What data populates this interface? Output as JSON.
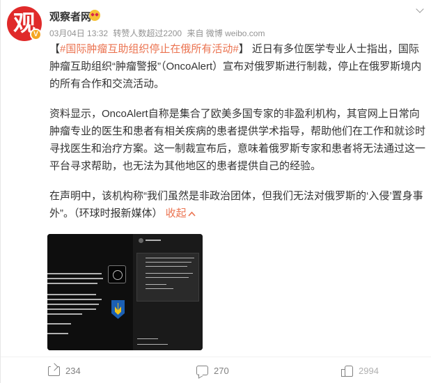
{
  "header": {
    "avatar_glyph": "观",
    "user_name": "观察者网",
    "emoji_icon": "heart-eyes-emoji-icon",
    "date": "03月04日 13:32",
    "reposts_over": "转赞人数超过2200",
    "source": "来自 微博 weibo.com"
  },
  "post": {
    "bracket_open": "【",
    "hashtag": "#国际肿瘤互助组织停止在俄所有活动#",
    "bracket_close": "】",
    "p1_text": "近日有多位医学专业人士指出，国际肿瘤互助组织“肿瘤警报”（OncoAlert）宣布对俄罗斯进行制裁，停止在俄罗斯境内的所有合作和交流活动。",
    "p2_text": "资料显示，OncoAlert自称是集合了欧美多国专家的非盈利机构，其官网上日常向肿瘤专业的医生和患者有相关疾病的患者提供学术指导，帮助他们在工作和就诊时寻找医生和治疗方案。这一制裁宣布后，意味着俄罗斯专家和患者将无法通过这一平台寻求帮助，也无法为其他地区的患者提供自己的经验。",
    "p3_text": "在声明中，该机构称“我们虽然是非政治团体，但我们无法对俄罗斯的‘入侵’置身事外”。（环球时报新媒体）",
    "collapse_label": "收起",
    "collapse_icon": "chevron-up-icon"
  },
  "actions": {
    "share_count": "234",
    "comment_count": "270",
    "like_count": "2994"
  },
  "colors": {
    "accent": "#eb7350",
    "avatar_bg": "#e02a2a",
    "verified_badge": "#f5a623"
  }
}
